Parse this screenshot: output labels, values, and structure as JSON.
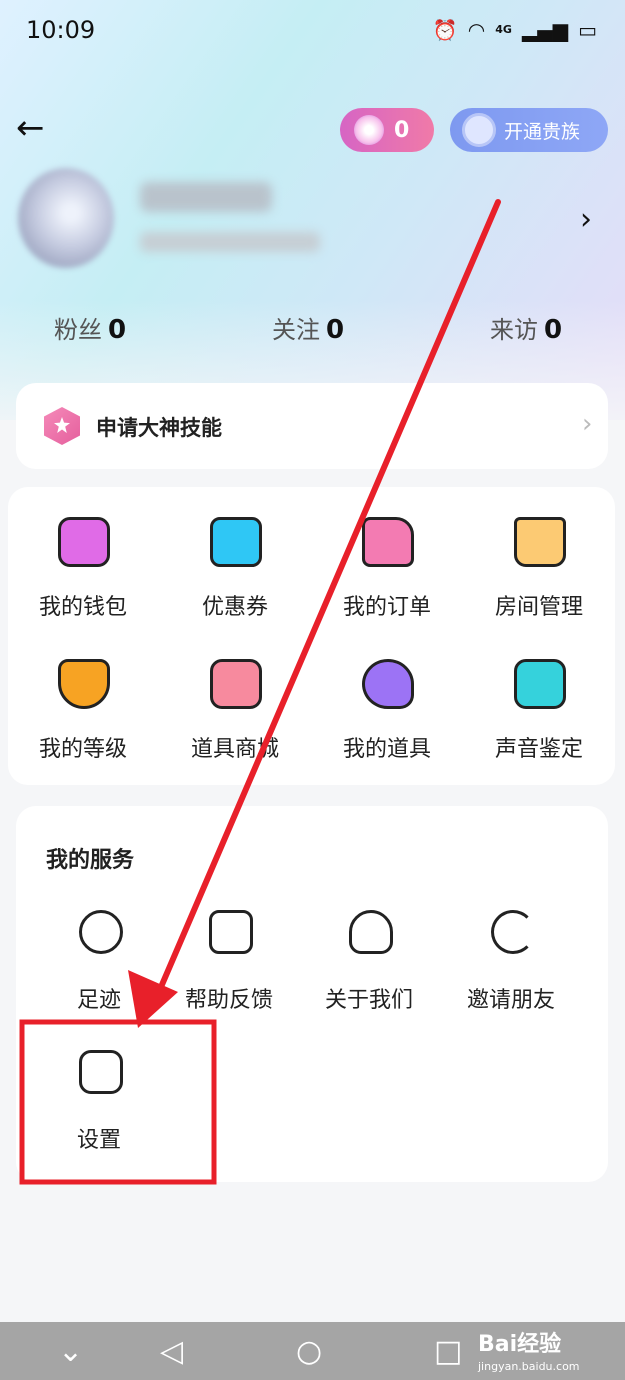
{
  "status_bar": {
    "time": "10:09",
    "network": "4G"
  },
  "header": {
    "coin_count": "0",
    "vip_label": "开通贵族"
  },
  "stats": [
    {
      "label": "粉丝",
      "value": "0"
    },
    {
      "label": "关注",
      "value": "0"
    },
    {
      "label": "来访",
      "value": "0"
    }
  ],
  "apply": {
    "label": "申请大神技能"
  },
  "grid": [
    {
      "label": "我的钱包",
      "icon": "wallet-icon",
      "color": "#e06be7"
    },
    {
      "label": "优惠券",
      "icon": "coupon-icon",
      "color": "#2fc7f5"
    },
    {
      "label": "我的订单",
      "icon": "order-icon",
      "color": "#f37bb2"
    },
    {
      "label": "房间管理",
      "icon": "house-icon",
      "color": "#fcca73"
    },
    {
      "label": "我的等级",
      "icon": "level-icon",
      "color": "#f7a323"
    },
    {
      "label": "道具商城",
      "icon": "shop-bag-icon",
      "color": "#f78a9e"
    },
    {
      "label": "我的道具",
      "icon": "star-wand-icon",
      "color": "#9c73f5"
    },
    {
      "label": "声音鉴定",
      "icon": "voice-wave-icon",
      "color": "#35d2dc"
    }
  ],
  "services": {
    "title": "我的服务",
    "items": [
      {
        "label": "足迹",
        "icon": "clock-icon"
      },
      {
        "label": "帮助反馈",
        "icon": "help-icon"
      },
      {
        "label": "关于我们",
        "icon": "user-icon"
      },
      {
        "label": "邀请朋友",
        "icon": "invite-icon"
      },
      {
        "label": "设置",
        "icon": "settings-icon"
      }
    ]
  },
  "watermark": {
    "brand": "Bai经验",
    "url": "jingyan.baidu.com"
  },
  "annotation_color": "#e8202a"
}
